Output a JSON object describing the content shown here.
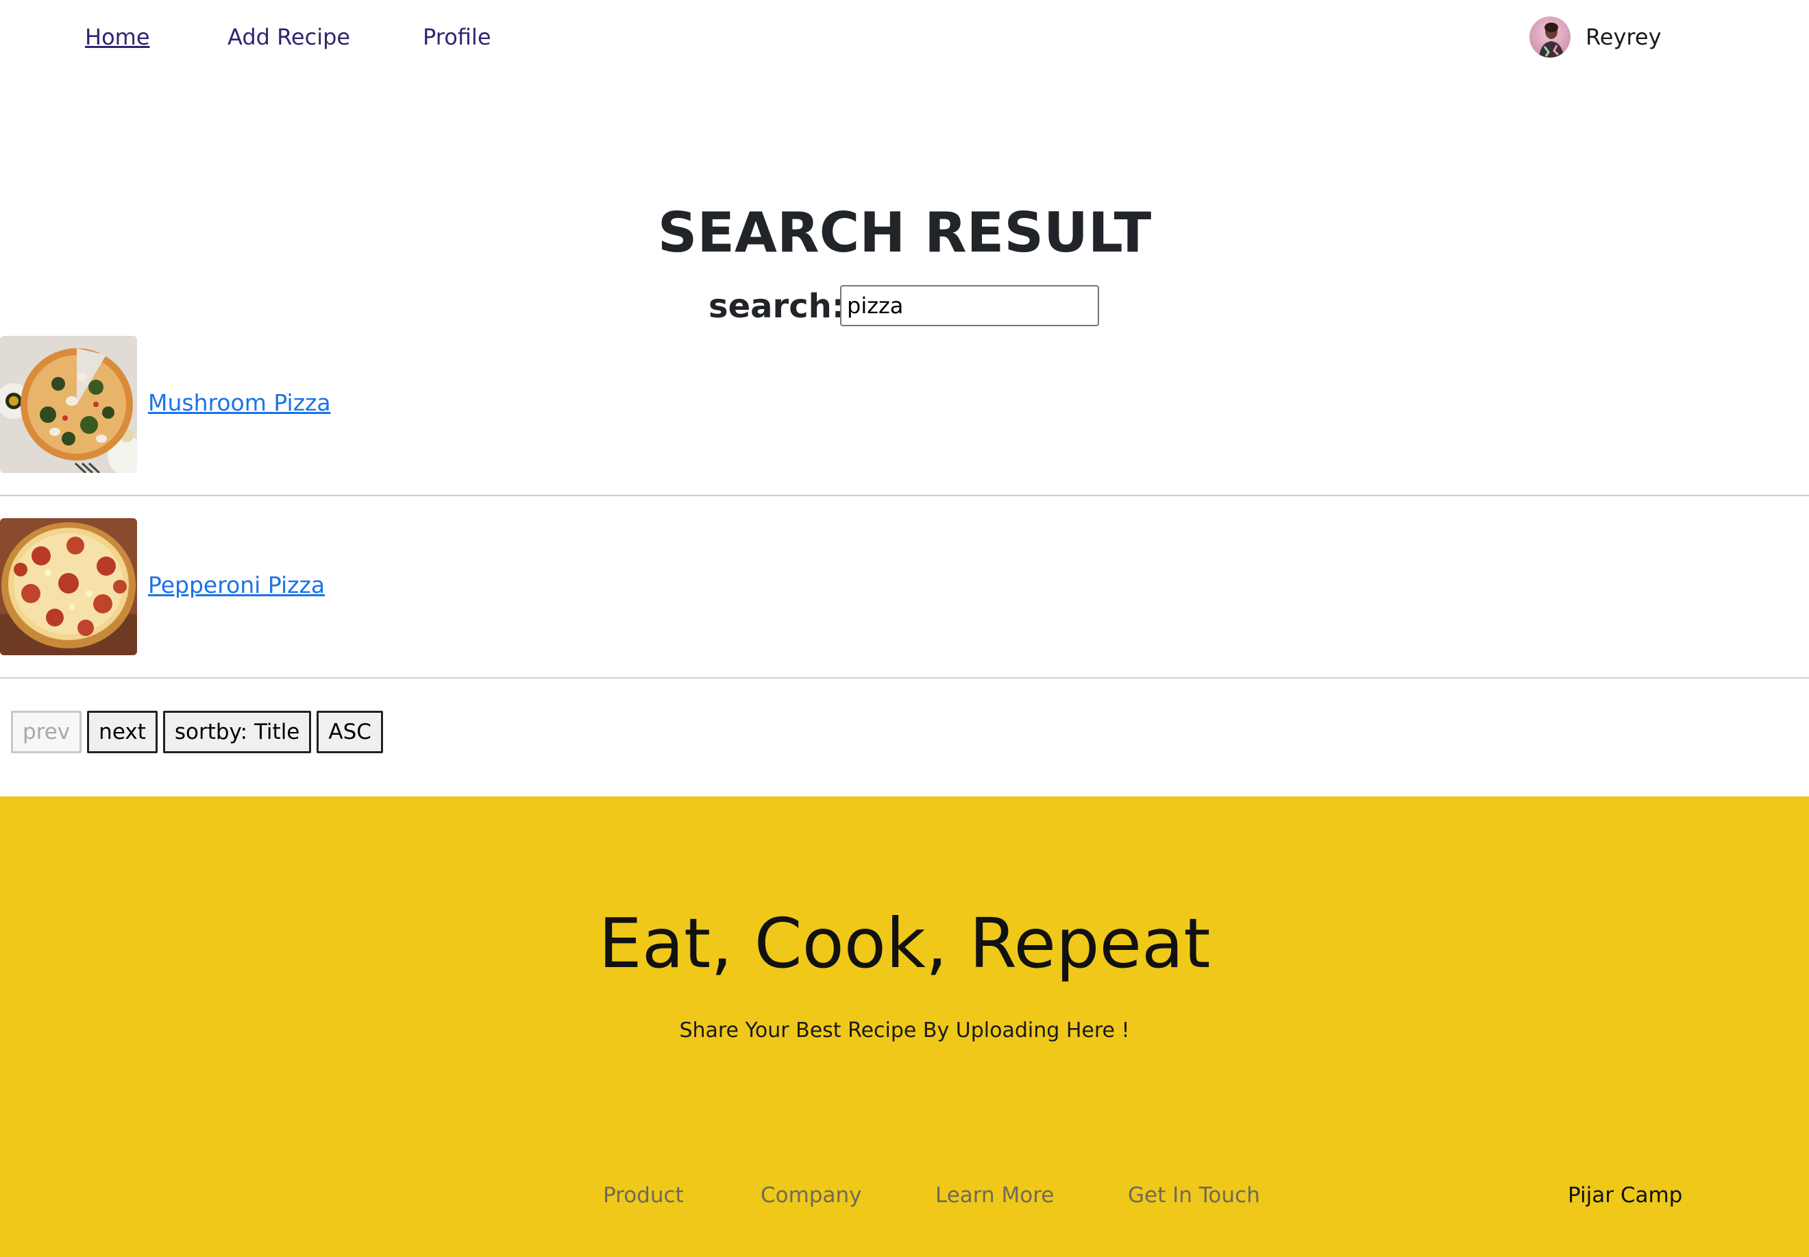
{
  "nav": {
    "links": [
      {
        "label": "Home",
        "active": true
      },
      {
        "label": "Add Recipe",
        "active": false
      },
      {
        "label": "Profile",
        "active": false
      }
    ],
    "user": {
      "name": "Reyrey",
      "avatar_icon": "user-avatar"
    }
  },
  "search": {
    "title": "SEARCH RESULT",
    "label": "search:",
    "value": "pizza"
  },
  "results": [
    {
      "title": "Mushroom Pizza",
      "image": "mushroom-pizza-photo"
    },
    {
      "title": "Pepperoni Pizza",
      "image": "pepperoni-pizza-photo"
    }
  ],
  "pagination": {
    "prev_label": "prev",
    "prev_disabled": true,
    "next_label": "next",
    "sort_label": "sortby: Title",
    "order_label": "ASC"
  },
  "footer": {
    "title": "Eat, Cook, Repeat",
    "subtitle": "Share Your Best Recipe By Uploading Here !",
    "links": [
      "Product",
      "Company",
      "Learn More",
      "Get In Touch"
    ],
    "brand": "Pijar Camp",
    "background": "#efc81a"
  },
  "colors": {
    "nav_link": "#2e266f",
    "result_link": "#1a73e8",
    "footer_bg": "#efc81a"
  }
}
